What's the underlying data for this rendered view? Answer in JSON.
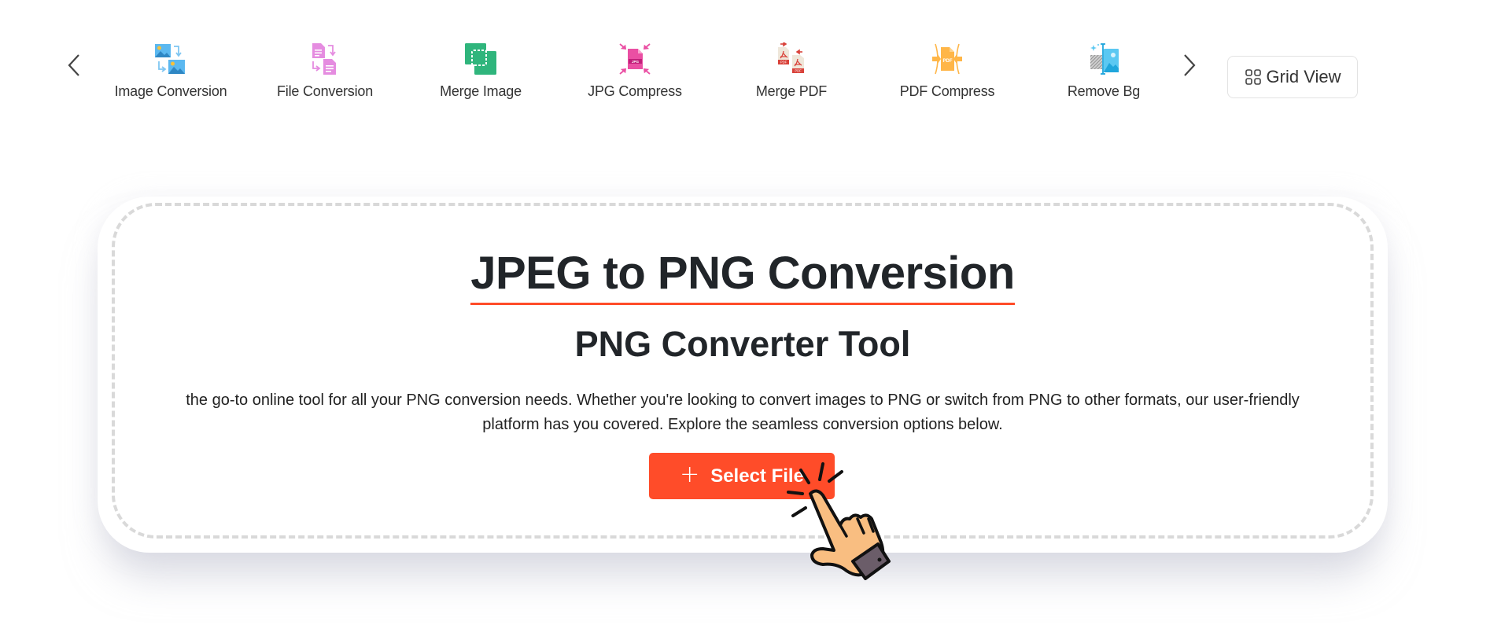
{
  "nav": {
    "prev_label": "Previous",
    "next_label": "Next",
    "tools": [
      {
        "id": "image-conversion",
        "label": "Image Conversion",
        "icon": "image-conversion-icon"
      },
      {
        "id": "file-conversion",
        "label": "File Conversion",
        "icon": "file-conversion-icon"
      },
      {
        "id": "merge-image",
        "label": "Merge Image",
        "icon": "merge-image-icon"
      },
      {
        "id": "jpg-compress",
        "label": "JPG Compress",
        "icon": "jpg-compress-icon"
      },
      {
        "id": "merge-pdf",
        "label": "Merge PDF",
        "icon": "merge-pdf-icon"
      },
      {
        "id": "pdf-compress",
        "label": "PDF Compress",
        "icon": "pdf-compress-icon"
      },
      {
        "id": "remove-bg",
        "label": "Remove Bg",
        "icon": "remove-bg-icon"
      }
    ],
    "grid_view_label": "Grid View"
  },
  "hero": {
    "title": "JPEG to PNG Conversion",
    "subtitle": "PNG Converter Tool",
    "description": "the go-to online tool for all your PNG conversion needs. Whether you're looking to convert images to PNG or switch from PNG to other formats, our user-friendly platform has you covered. Explore the seamless conversion options below.",
    "select_file_label": "Select File",
    "select_file_icon": "+"
  },
  "colors": {
    "accent": "#ff4c29",
    "text": "#212529",
    "dashed_border": "#d9d9d9",
    "image_icon": "#5bb8f0",
    "file_icon": "#e58ce0",
    "merge_icon": "#2fb57c",
    "jpg_icon": "#ea4fa3",
    "pdf_red": "#d9423a",
    "pdf_compress": "#ffb648"
  }
}
